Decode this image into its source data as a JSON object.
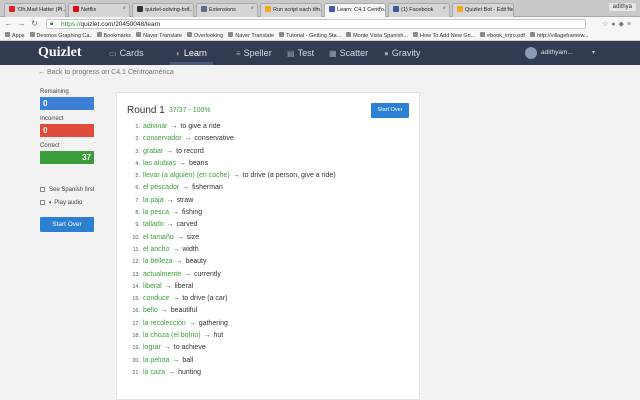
{
  "browser": {
    "tabs": [
      {
        "title": "'Oh,Mad Hatter (Pi...",
        "color": "#e02020"
      },
      {
        "title": "Netflix",
        "color": "#e50914"
      },
      {
        "title": "quizlet-solving-bot...",
        "color": "#333333"
      },
      {
        "title": "Extensions",
        "color": "#5f6e8c"
      },
      {
        "title": "Run script each tim...",
        "color": "#f2a71b"
      },
      {
        "title": "Learn: C4.1 Centro...",
        "color": "#4257b2"
      },
      {
        "title": "(1) Facebook",
        "color": "#3b5998"
      },
      {
        "title": "Quizlet Bot - Edit Ite...",
        "color": "#f2a71b"
      }
    ],
    "active_tab": 5,
    "window_user": "adithya",
    "url_https": "https://",
    "url_rest": "quizlet.com/20450048/learn",
    "bookmarks": [
      "Apps",
      "Desmos Graphing Ca...",
      "Bookmarks",
      "Naver Translate",
      "Overlooking",
      "Naver Translate",
      "Tutorial - Getting Sta...",
      "Monte Vista Spanish...",
      "How To Add New Gri...",
      "ebook_intro.pdf",
      "http://villageframew..."
    ]
  },
  "nav": {
    "logo": "Quizlet",
    "tabs": [
      "Cards",
      "Learn",
      "Speller",
      "Test",
      "Scatter",
      "Gravity"
    ],
    "tab_icons": [
      "▭",
      "◐",
      "≡",
      "▤",
      "▦",
      "●"
    ],
    "user": "adithyam..."
  },
  "back_link": "← Back to progress on C4.1 Centroamérica",
  "sidebar": {
    "remaining_label": "Remaining",
    "remaining": "0",
    "incorrect_label": "Incorrect",
    "incorrect": "0",
    "correct_label": "Correct",
    "correct": "37",
    "see_spanish": "See Spanish first",
    "play_audio": "Play audio",
    "start_over": "Start Over"
  },
  "round": {
    "title": "Round 1",
    "stats": "37/37 - 100%",
    "start_over": "Start Over"
  },
  "terms": [
    {
      "n": "1.",
      "word": "adivinar",
      "def": "to give a ride"
    },
    {
      "n": "2.",
      "word": "conservador",
      "def": "conservative"
    },
    {
      "n": "3.",
      "word": "grabar",
      "def": "to record"
    },
    {
      "n": "4.",
      "word": "las alubias",
      "def": "beans"
    },
    {
      "n": "5.",
      "word": "llevar (a alguien) (en coche)",
      "def": "to drive (a person, give a ride)"
    },
    {
      "n": "6.",
      "word": "el pescador",
      "def": "fisherman"
    },
    {
      "n": "7.",
      "word": "la paja",
      "def": "straw"
    },
    {
      "n": "8.",
      "word": "la pesca",
      "def": "fishing"
    },
    {
      "n": "9.",
      "word": "tallado",
      "def": "carved"
    },
    {
      "n": "10.",
      "word": "el tamaño",
      "def": "size"
    },
    {
      "n": "11.",
      "word": "el ancho",
      "def": "width"
    },
    {
      "n": "12.",
      "word": "la belleza",
      "def": "beauty"
    },
    {
      "n": "13.",
      "word": "actualmente",
      "def": "currently"
    },
    {
      "n": "14.",
      "word": "liberal",
      "def": "liberal"
    },
    {
      "n": "15.",
      "word": "conducir",
      "def": "to drive (a car)"
    },
    {
      "n": "16.",
      "word": "bello",
      "def": "beautiful"
    },
    {
      "n": "17.",
      "word": "la recolección",
      "def": "gathering"
    },
    {
      "n": "18.",
      "word": "la choza (el bohío)",
      "def": "hut"
    },
    {
      "n": "19.",
      "word": "lograr",
      "def": "to achieve"
    },
    {
      "n": "20.",
      "word": "la pelota",
      "def": "ball"
    },
    {
      "n": "21.",
      "word": "la caza",
      "def": "hunting"
    }
  ],
  "colors": {
    "header": "#313b51",
    "green": "#3c9e3a",
    "blue": "#2c7fd1",
    "red": "#e04b3c"
  }
}
